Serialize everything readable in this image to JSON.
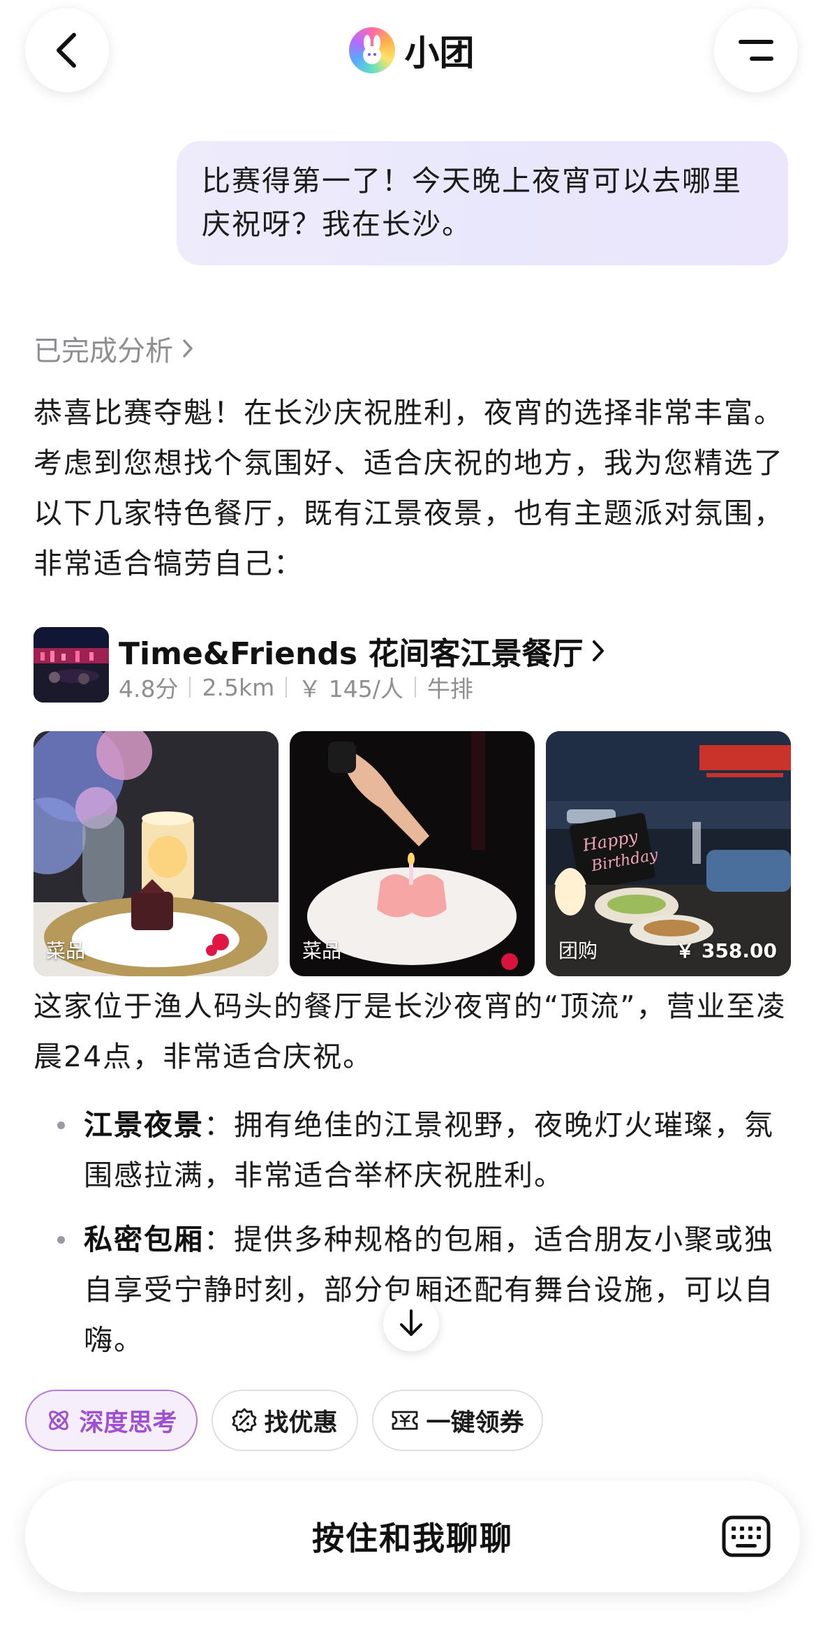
{
  "header": {
    "title": "小团",
    "back_icon": "chevron-left-icon",
    "menu_icon": "menu-icon"
  },
  "user_message": "比赛得第一了！今天晚上夜宵可以去哪里庆祝呀？我在长沙。",
  "analysis_label": "已完成分析",
  "intro": "恭喜比赛夺魁！在长沙庆祝胜利，夜宵的选择非常丰富。考虑到您想找个氛围好、适合庆祝的地方，我为您精选了以下几家特色餐厅，既有江景夜景，也有主题派对氛围，非常适合犒劳自己：",
  "restaurant": {
    "name": "Time&Friends 花间客江景餐厅",
    "rating": "4.8分",
    "distance": "2.5km",
    "price": "￥ 145/人",
    "category": "牛排",
    "photos": [
      {
        "tag": "菜品",
        "price": ""
      },
      {
        "tag": "菜品",
        "price": ""
      },
      {
        "tag": "团购",
        "price": "￥ 358.00"
      }
    ],
    "photo3_sign": [
      "Happy",
      "Birthday"
    ]
  },
  "description": "这家位于渔人码头的餐厅是长沙夜宵的“顶流”，营业至凌晨24点，非常适合庆祝。",
  "bullets": [
    {
      "title": "江景夜景",
      "text": "：拥有绝佳的江景视野，夜晚灯火璀璨，氛围感拉满，非常适合举杯庆祝胜利。"
    },
    {
      "title": "私密包厢",
      "text": "：提供多种规格的包厢，适合朋友小聚或独自享受宁静时刻，部分包厢还配有舞台设施，可以自嗨。"
    }
  ],
  "chips": {
    "deep_think": "深度思考",
    "find_deals": "找优惠",
    "get_coupon": "一键领券"
  },
  "voice_bar": {
    "label": "按住和我聊聊"
  },
  "colors": {
    "accent_purple": "#9f4fd1",
    "bubble_bg": "#ebe9fb",
    "muted_text": "#8e8e93"
  }
}
